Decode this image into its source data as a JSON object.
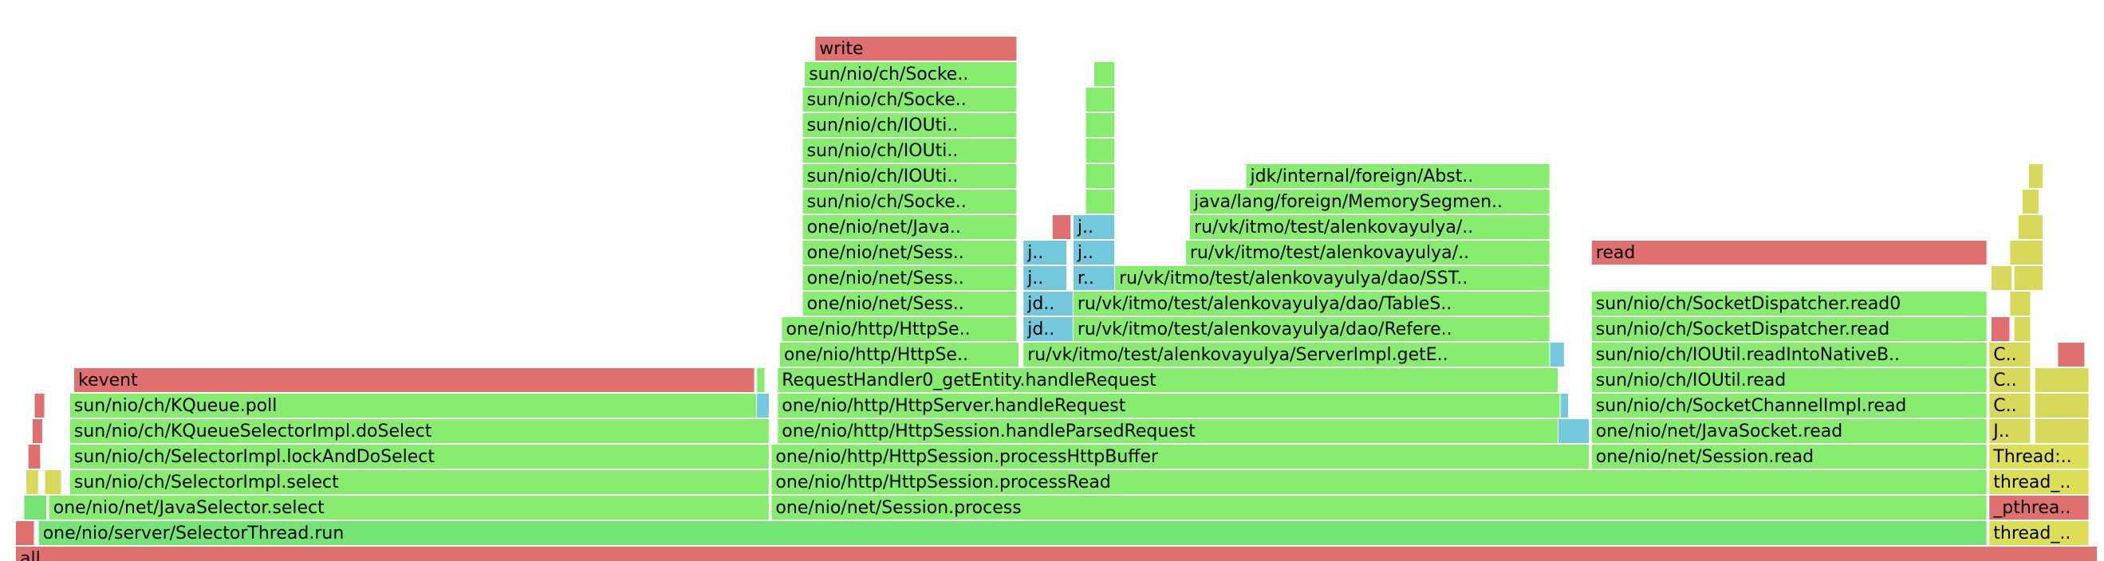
{
  "chart_data": {
    "type": "flamegraph",
    "x_range": [
      0,
      100
    ],
    "depth_count": 22,
    "frames": [
      {
        "label": "all",
        "x0": 0.0,
        "x1": 100.0,
        "depth": 0,
        "color": "#e07070"
      },
      {
        "label": "",
        "x0": 0.0,
        "x1": 0.9,
        "depth": 1,
        "color": "#e07070"
      },
      {
        "label": "one/nio/server/SelectorThread.run",
        "x0": 1.1,
        "x1": 94.7,
        "depth": 1,
        "color": "#74e474"
      },
      {
        "label": "thread_..",
        "x0": 94.8,
        "x1": 99.6,
        "depth": 1,
        "color": "#dede56"
      },
      {
        "label": "",
        "x0": 0.4,
        "x1": 1.5,
        "depth": 2,
        "color": "#74e474"
      },
      {
        "label": "one/nio/net/JavaSelector.select",
        "x0": 1.6,
        "x1": 36.2,
        "depth": 2,
        "color": "#86ec6e"
      },
      {
        "label": "one/nio/net/Session.process",
        "x0": 36.3,
        "x1": 94.7,
        "depth": 2,
        "color": "#86ec6e"
      },
      {
        "label": "_pthrea..",
        "x0": 94.8,
        "x1": 99.6,
        "depth": 2,
        "color": "#e07070"
      },
      {
        "label": "",
        "x0": 0.5,
        "x1": 1.1,
        "depth": 3,
        "color": "#d8d85a"
      },
      {
        "label": "",
        "x0": 1.4,
        "x1": 2.2,
        "depth": 3,
        "color": "#d8d85a"
      },
      {
        "label": "sun/nio/ch/SelectorImpl.select",
        "x0": 2.6,
        "x1": 36.2,
        "depth": 3,
        "color": "#86ec6e"
      },
      {
        "label": "one/nio/http/HttpSession.processRead",
        "x0": 36.3,
        "x1": 94.7,
        "depth": 3,
        "color": "#86ec6e"
      },
      {
        "label": "thread_..",
        "x0": 94.8,
        "x1": 99.6,
        "depth": 3,
        "color": "#dede56"
      },
      {
        "label": "",
        "x0": 0.6,
        "x1": 1.2,
        "depth": 4,
        "color": "#e07070"
      },
      {
        "label": "sun/nio/ch/SelectorImpl.lockAndDoSelect",
        "x0": 2.6,
        "x1": 36.2,
        "depth": 4,
        "color": "#86ec6e"
      },
      {
        "label": "one/nio/http/HttpSession.processHttpBuffer",
        "x0": 36.3,
        "x1": 75.6,
        "depth": 4,
        "color": "#86ec6e"
      },
      {
        "label": "one/nio/net/Session.read",
        "x0": 75.7,
        "x1": 94.7,
        "depth": 4,
        "color": "#86ec6e"
      },
      {
        "label": "Thread:..",
        "x0": 94.8,
        "x1": 99.6,
        "depth": 4,
        "color": "#dede56"
      },
      {
        "label": "",
        "x0": 0.8,
        "x1": 1.3,
        "depth": 5,
        "color": "#e07070"
      },
      {
        "label": "sun/nio/ch/KQueueSelectorImpl.doSelect",
        "x0": 2.6,
        "x1": 36.2,
        "depth": 5,
        "color": "#86ec6e"
      },
      {
        "label": "one/nio/http/HttpSession.handleParsedRequest",
        "x0": 36.6,
        "x1": 74.1,
        "depth": 5,
        "color": "#86ec6e"
      },
      {
        "label": "",
        "x0": 74.1,
        "x1": 75.6,
        "depth": 5,
        "color": "#74c8dc"
      },
      {
        "label": "one/nio/net/JavaSocket.read",
        "x0": 75.7,
        "x1": 94.7,
        "depth": 5,
        "color": "#86ec6e"
      },
      {
        "label": "J..",
        "x0": 94.8,
        "x1": 96.8,
        "depth": 5,
        "color": "#d8d85a"
      },
      {
        "label": "",
        "x0": 97.0,
        "x1": 99.6,
        "depth": 5,
        "color": "#d8d85a"
      },
      {
        "label": "",
        "x0": 0.9,
        "x1": 1.4,
        "depth": 6,
        "color": "#e07070"
      },
      {
        "label": "sun/nio/ch/KQueue.poll",
        "x0": 2.6,
        "x1": 35.6,
        "depth": 6,
        "color": "#86ec6e"
      },
      {
        "label": "",
        "x0": 35.6,
        "x1": 36.2,
        "depth": 6,
        "color": "#74c8dc"
      },
      {
        "label": "one/nio/http/HttpServer.handleRequest",
        "x0": 36.6,
        "x1": 74.2,
        "depth": 6,
        "color": "#86ec6e"
      },
      {
        "label": "",
        "x0": 74.2,
        "x1": 74.6,
        "depth": 6,
        "color": "#74c8dc"
      },
      {
        "label": "sun/nio/ch/SocketChannelImpl.read",
        "x0": 75.7,
        "x1": 94.7,
        "depth": 6,
        "color": "#86ec6e"
      },
      {
        "label": "C..",
        "x0": 94.8,
        "x1": 96.8,
        "depth": 6,
        "color": "#d8d85a"
      },
      {
        "label": "",
        "x0": 97.0,
        "x1": 99.6,
        "depth": 6,
        "color": "#d8d85a"
      },
      {
        "label": "kevent",
        "x0": 2.8,
        "x1": 35.5,
        "depth": 7,
        "color": "#e07070"
      },
      {
        "label": "",
        "x0": 35.6,
        "x1": 36.0,
        "depth": 7,
        "color": "#86ec6e"
      },
      {
        "label": "RequestHandler0_getEntity.handleRequest",
        "x0": 36.6,
        "x1": 74.1,
        "depth": 7,
        "color": "#86ec6e"
      },
      {
        "label": "sun/nio/ch/IOUtil.read",
        "x0": 75.7,
        "x1": 94.7,
        "depth": 7,
        "color": "#86ec6e"
      },
      {
        "label": "C..",
        "x0": 94.8,
        "x1": 96.8,
        "depth": 7,
        "color": "#d8d85a"
      },
      {
        "label": "",
        "x0": 97.0,
        "x1": 99.6,
        "depth": 7,
        "color": "#d8d85a"
      },
      {
        "label": "one/nio/http/HttpSe..",
        "x0": 36.7,
        "x1": 48.2,
        "depth": 8,
        "color": "#86ec6e"
      },
      {
        "label": "ru/vk/itmo/test/alenkovayulya/ServerImpl.getE..",
        "x0": 48.4,
        "x1": 73.7,
        "depth": 8,
        "color": "#86ec6e"
      },
      {
        "label": "",
        "x0": 73.7,
        "x1": 74.4,
        "depth": 8,
        "color": "#74c8dc"
      },
      {
        "label": "sun/nio/ch/IOUtil.readIntoNativeB..",
        "x0": 75.7,
        "x1": 94.7,
        "depth": 8,
        "color": "#86ec6e"
      },
      {
        "label": "C..",
        "x0": 94.8,
        "x1": 96.8,
        "depth": 8,
        "color": "#d8d85a"
      },
      {
        "label": "",
        "x0": 98.1,
        "x1": 99.4,
        "depth": 8,
        "color": "#e07070"
      },
      {
        "label": "one/nio/http/HttpSe..",
        "x0": 36.8,
        "x1": 48.1,
        "depth": 9,
        "color": "#86ec6e"
      },
      {
        "label": "jd..",
        "x0": 48.4,
        "x1": 50.8,
        "depth": 9,
        "color": "#74c8dc"
      },
      {
        "label": "ru/vk/itmo/test/alenkovayulya/dao/Refere..",
        "x0": 50.8,
        "x1": 73.7,
        "depth": 9,
        "color": "#86ec6e"
      },
      {
        "label": "sun/nio/ch/SocketDispatcher.read",
        "x0": 75.7,
        "x1": 94.7,
        "depth": 9,
        "color": "#86ec6e"
      },
      {
        "label": "",
        "x0": 94.9,
        "x1": 95.8,
        "depth": 9,
        "color": "#e07070"
      },
      {
        "label": "",
        "x0": 96.0,
        "x1": 96.8,
        "depth": 9,
        "color": "#d8d85a"
      },
      {
        "label": "one/nio/net/Sess..",
        "x0": 37.8,
        "x1": 48.1,
        "depth": 10,
        "color": "#86ec6e"
      },
      {
        "label": "jd..",
        "x0": 48.4,
        "x1": 50.8,
        "depth": 10,
        "color": "#74c8dc"
      },
      {
        "label": "ru/vk/itmo/test/alenkovayulya/dao/TableS..",
        "x0": 50.8,
        "x1": 73.7,
        "depth": 10,
        "color": "#86ec6e"
      },
      {
        "label": "sun/nio/ch/SocketDispatcher.read0",
        "x0": 75.7,
        "x1": 94.7,
        "depth": 10,
        "color": "#86ec6e"
      },
      {
        "label": "",
        "x0": 95.8,
        "x1": 96.8,
        "depth": 10,
        "color": "#d8d85a"
      },
      {
        "label": "one/nio/net/Sess..",
        "x0": 37.8,
        "x1": 48.1,
        "depth": 11,
        "color": "#86ec6e"
      },
      {
        "label": "ja..",
        "x0": 48.4,
        "x1": 50.5,
        "depth": 11,
        "color": "#74c8dc"
      },
      {
        "label": "r..",
        "x0": 50.8,
        "x1": 52.8,
        "depth": 11,
        "color": "#74c8dc"
      },
      {
        "label": "ru/vk/itmo/test/alenkovayulya/dao/SST..",
        "x0": 52.8,
        "x1": 73.7,
        "depth": 11,
        "color": "#86ec6e"
      },
      {
        "label": "",
        "x0": 94.9,
        "x1": 95.9,
        "depth": 11,
        "color": "#d8d85a"
      },
      {
        "label": "",
        "x0": 96.0,
        "x1": 97.4,
        "depth": 11,
        "color": "#d8d85a"
      },
      {
        "label": "one/nio/net/Sess..",
        "x0": 37.8,
        "x1": 48.1,
        "depth": 12,
        "color": "#86ec6e"
      },
      {
        "label": "ja..",
        "x0": 48.4,
        "x1": 50.5,
        "depth": 12,
        "color": "#74c8dc"
      },
      {
        "label": "j..",
        "x0": 50.8,
        "x1": 52.8,
        "depth": 12,
        "color": "#74c8dc"
      },
      {
        "label": "ru/vk/itmo/test/alenkovayulya/..",
        "x0": 56.2,
        "x1": 73.7,
        "depth": 12,
        "color": "#86ec6e"
      },
      {
        "label": "read",
        "x0": 75.7,
        "x1": 94.7,
        "depth": 12,
        "color": "#e07070"
      },
      {
        "label": "",
        "x0": 95.8,
        "x1": 97.4,
        "depth": 12,
        "color": "#d8d85a"
      },
      {
        "label": "one/nio/net/Java..",
        "x0": 37.8,
        "x1": 48.1,
        "depth": 13,
        "color": "#86ec6e"
      },
      {
        "label": "",
        "x0": 49.8,
        "x1": 50.7,
        "depth": 13,
        "color": "#e07070"
      },
      {
        "label": "j..",
        "x0": 50.8,
        "x1": 52.8,
        "depth": 13,
        "color": "#74c8dc"
      },
      {
        "label": "ru/vk/itmo/test/alenkovayulya/..",
        "x0": 56.4,
        "x1": 73.7,
        "depth": 13,
        "color": "#86ec6e"
      },
      {
        "label": "",
        "x0": 96.2,
        "x1": 97.4,
        "depth": 13,
        "color": "#d8d85a"
      },
      {
        "label": "sun/nio/ch/Socke..",
        "x0": 37.8,
        "x1": 48.1,
        "depth": 14,
        "color": "#86ec6e"
      },
      {
        "label": "",
        "x0": 51.4,
        "x1": 52.8,
        "depth": 14,
        "color": "#86ec6e"
      },
      {
        "label": "java/lang/foreign/MemorySegmen..",
        "x0": 56.4,
        "x1": 73.7,
        "depth": 14,
        "color": "#86ec6e"
      },
      {
        "label": "",
        "x0": 96.4,
        "x1": 97.2,
        "depth": 14,
        "color": "#d8d85a"
      },
      {
        "label": "sun/nio/ch/IOUti..",
        "x0": 37.8,
        "x1": 48.1,
        "depth": 15,
        "color": "#86ec6e"
      },
      {
        "label": "",
        "x0": 51.4,
        "x1": 52.8,
        "depth": 15,
        "color": "#86ec6e"
      },
      {
        "label": "jdk/internal/foreign/Abst..",
        "x0": 59.1,
        "x1": 73.7,
        "depth": 15,
        "color": "#86ec6e"
      },
      {
        "label": "",
        "x0": 96.7,
        "x1": 97.4,
        "depth": 15,
        "color": "#d8d85a"
      },
      {
        "label": "sun/nio/ch/IOUti..",
        "x0": 37.8,
        "x1": 48.1,
        "depth": 16,
        "color": "#86ec6e"
      },
      {
        "label": "",
        "x0": 51.4,
        "x1": 52.8,
        "depth": 16,
        "color": "#86ec6e"
      },
      {
        "label": "sun/nio/ch/IOUti..",
        "x0": 37.8,
        "x1": 48.1,
        "depth": 17,
        "color": "#86ec6e"
      },
      {
        "label": "",
        "x0": 51.4,
        "x1": 52.8,
        "depth": 17,
        "color": "#86ec6e"
      },
      {
        "label": "sun/nio/ch/Socke..",
        "x0": 37.8,
        "x1": 48.1,
        "depth": 18,
        "color": "#86ec6e"
      },
      {
        "label": "",
        "x0": 51.4,
        "x1": 52.8,
        "depth": 18,
        "color": "#86ec6e"
      },
      {
        "label": "sun/nio/ch/Socke..",
        "x0": 37.9,
        "x1": 48.1,
        "depth": 19,
        "color": "#86ec6e"
      },
      {
        "label": "",
        "x0": 51.8,
        "x1": 52.8,
        "depth": 19,
        "color": "#86ec6e"
      },
      {
        "label": "write",
        "x0": 38.4,
        "x1": 48.1,
        "depth": 20,
        "color": "#e07070"
      }
    ]
  }
}
